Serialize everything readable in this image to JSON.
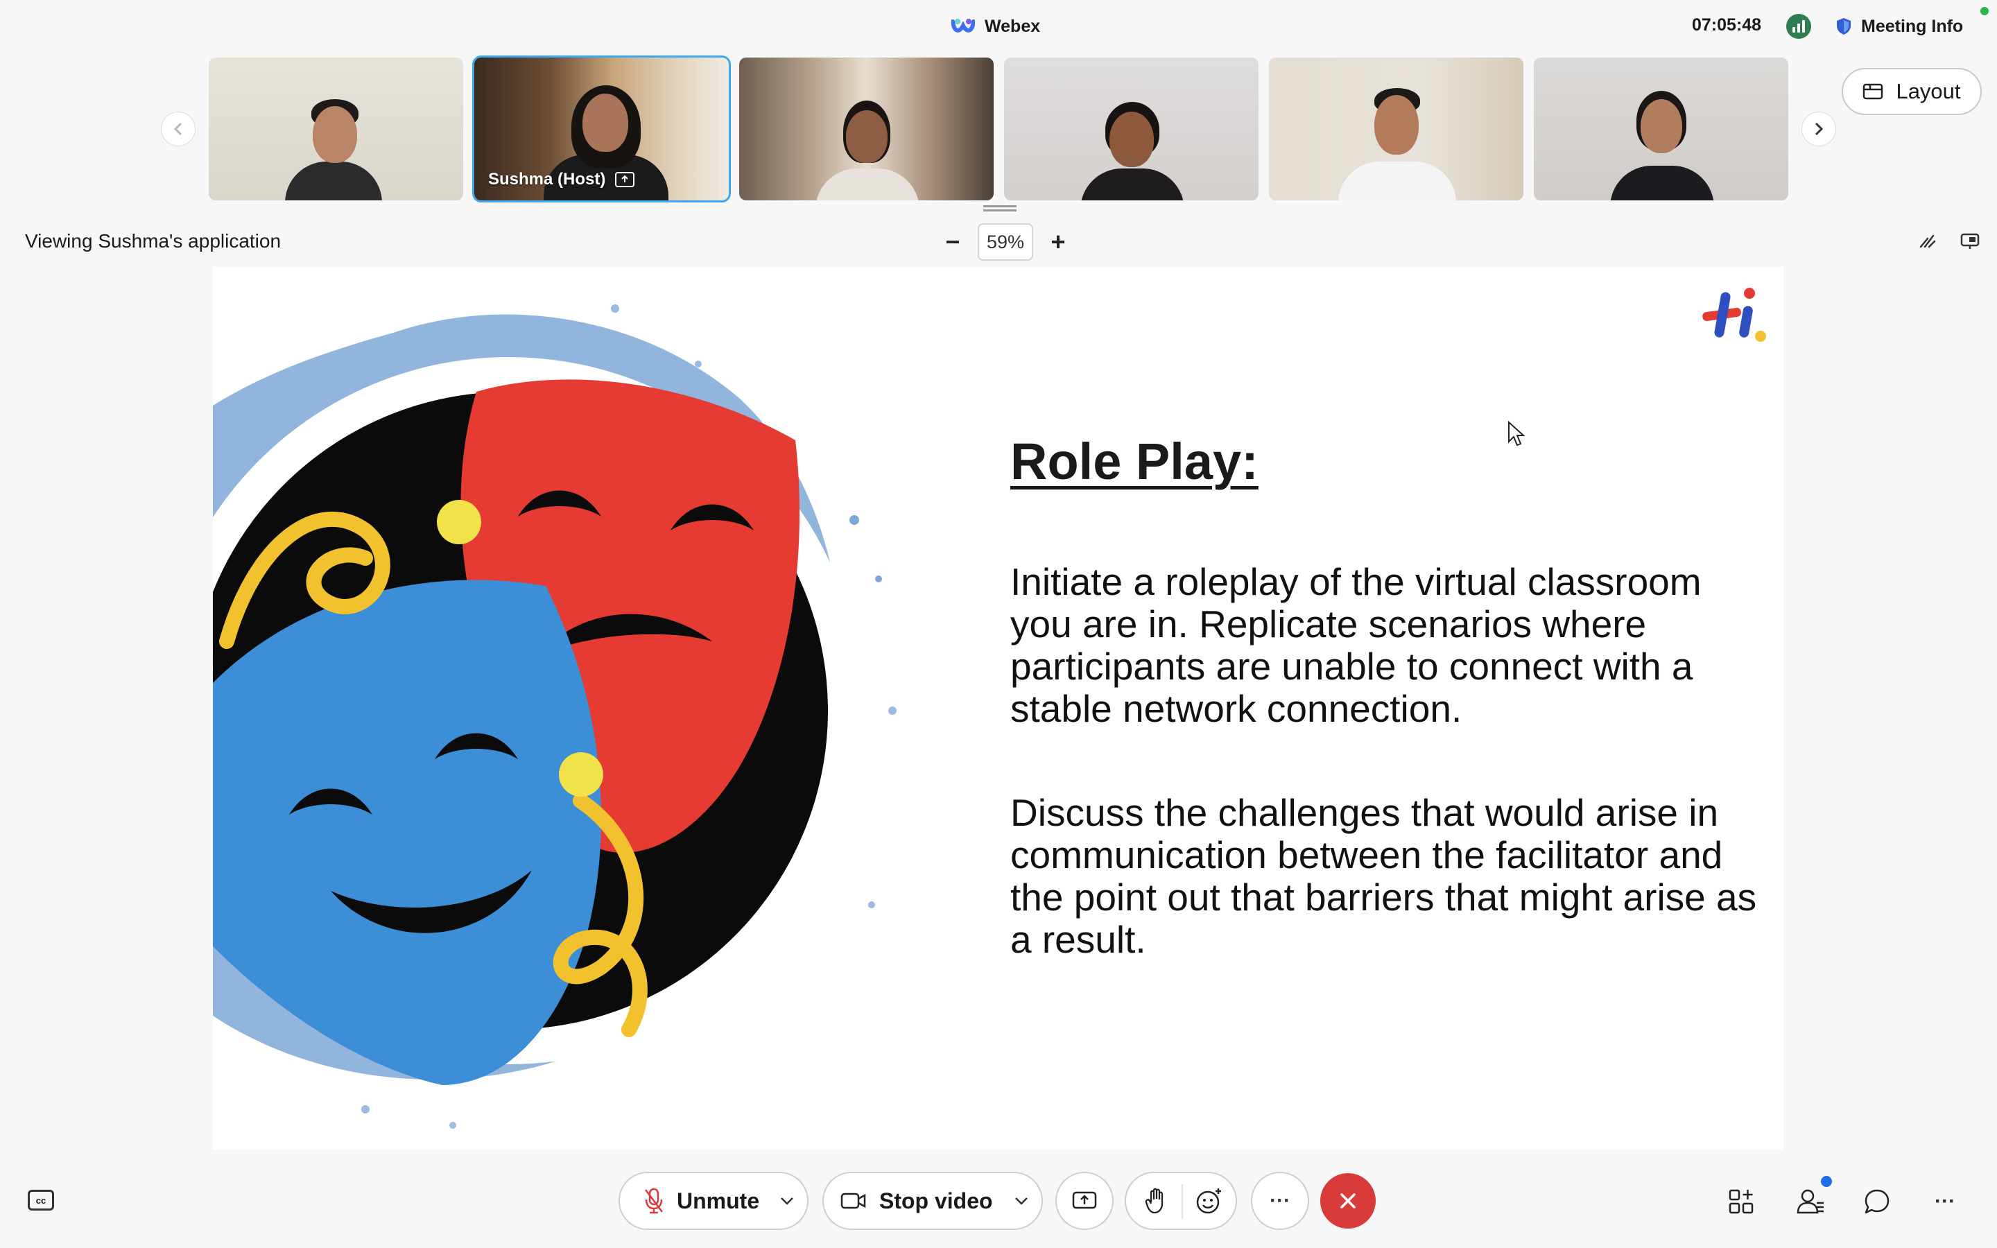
{
  "header": {
    "app_name": "Webex",
    "time": "07:05:48",
    "meeting_info_label": "Meeting Info",
    "layout_label": "Layout"
  },
  "filmstrip": {
    "participants": [
      {
        "label": ""
      },
      {
        "label": "Sushma  (Host)"
      },
      {
        "label": ""
      },
      {
        "label": ""
      },
      {
        "label": ""
      },
      {
        "label": ""
      }
    ]
  },
  "share": {
    "viewing_text": "Viewing Sushma's application",
    "zoom_value": "59%",
    "zoom_out": "−",
    "zoom_in": "+"
  },
  "slide": {
    "title": "Role Play:",
    "paragraph_1": "Initiate a roleplay of the virtual classroom you are in. Replicate scenarios where participants are unable to connect with a stable network connection.",
    "paragraph_2": "Discuss the challenges that would arise in communication between the facilitator and the point out that barriers that might arise as a result."
  },
  "controls": {
    "cc_label": "cc",
    "unmute_label": "Unmute",
    "stop_video_label": "Stop video",
    "more_label": "···",
    "overflow_label": "···"
  },
  "colors": {
    "accent_blue": "#3ea8ef",
    "end_call_red": "#d93a3a",
    "mask_red": "#e53b33",
    "mask_blue": "#3c8fd6",
    "ribbon_yellow": "#f2c12e"
  }
}
